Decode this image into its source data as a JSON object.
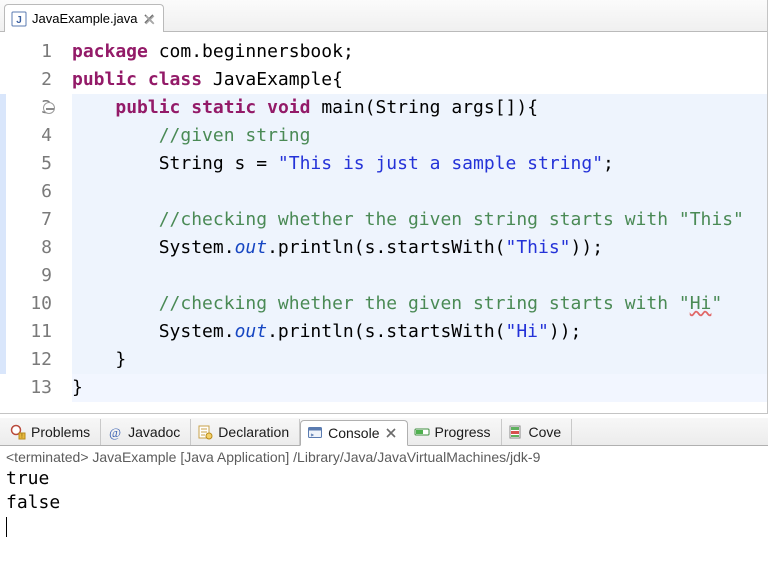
{
  "editor": {
    "tab": {
      "filename": "JavaExample.java"
    },
    "code_lines": [
      {
        "n": 1,
        "hl": false,
        "tokens": [
          [
            "kw",
            "package"
          ],
          [
            "",
            " "
          ],
          [
            "pkg",
            "com.beginnersbook"
          ],
          [
            "",
            ";"
          ]
        ]
      },
      {
        "n": 2,
        "hl": false,
        "tokens": [
          [
            "kw",
            "public"
          ],
          [
            "",
            " "
          ],
          [
            "kw",
            "class"
          ],
          [
            "",
            " "
          ],
          [
            "cls",
            "JavaExample"
          ],
          [
            "",
            "{"
          ]
        ]
      },
      {
        "n": 3,
        "hl": true,
        "fold": true,
        "tokens": [
          [
            "",
            "    "
          ],
          [
            "kw",
            "public"
          ],
          [
            "",
            " "
          ],
          [
            "kw",
            "static"
          ],
          [
            "",
            " "
          ],
          [
            "kw",
            "void"
          ],
          [
            "",
            " "
          ],
          [
            "",
            "main(String args[]){"
          ]
        ]
      },
      {
        "n": 4,
        "hl": true,
        "tokens": [
          [
            "",
            "        "
          ],
          [
            "cmt",
            "//given string"
          ]
        ]
      },
      {
        "n": 5,
        "hl": true,
        "tokens": [
          [
            "",
            "        "
          ],
          [
            "",
            "String s = "
          ],
          [
            "str",
            "\"This is just a sample string\""
          ],
          [
            "",
            ";"
          ]
        ]
      },
      {
        "n": 6,
        "hl": true,
        "tokens": []
      },
      {
        "n": 7,
        "hl": true,
        "tokens": [
          [
            "",
            "        "
          ],
          [
            "cmt",
            "//checking whether the given string starts with \"This\""
          ]
        ]
      },
      {
        "n": 8,
        "hl": true,
        "tokens": [
          [
            "",
            "        "
          ],
          [
            "",
            "System."
          ],
          [
            "fld",
            "out"
          ],
          [
            "",
            ".println(s.startsWith("
          ],
          [
            "str",
            "\"This\""
          ],
          [
            "",
            "));"
          ]
        ]
      },
      {
        "n": 9,
        "hl": true,
        "tokens": []
      },
      {
        "n": 10,
        "hl": true,
        "tokens": [
          [
            "",
            "        "
          ],
          [
            "cmt",
            "//checking whether the given string starts with \""
          ],
          [
            "cmt err",
            "Hi"
          ],
          [
            "cmt",
            "\""
          ]
        ]
      },
      {
        "n": 11,
        "hl": true,
        "tokens": [
          [
            "",
            "        "
          ],
          [
            "",
            "System."
          ],
          [
            "fld",
            "out"
          ],
          [
            "",
            ".println(s.startsWith("
          ],
          [
            "str",
            "\"Hi\""
          ],
          [
            "",
            "));"
          ]
        ]
      },
      {
        "n": 12,
        "hl": true,
        "tokens": [
          [
            "",
            "    }"
          ]
        ]
      },
      {
        "n": 13,
        "hl": false,
        "caret": true,
        "tokens": [
          [
            "",
            "}"
          ]
        ]
      }
    ]
  },
  "views": {
    "tabs": [
      {
        "id": "problems",
        "label": "Problems",
        "icon": "problems-icon"
      },
      {
        "id": "javadoc",
        "label": "Javadoc",
        "icon": "javadoc-icon"
      },
      {
        "id": "declaration",
        "label": "Declaration",
        "icon": "declaration-icon"
      },
      {
        "id": "console",
        "label": "Console",
        "icon": "console-icon",
        "active": true,
        "closable": true
      },
      {
        "id": "progress",
        "label": "Progress",
        "icon": "progress-icon"
      },
      {
        "id": "coverage",
        "label": "Cove",
        "icon": "coverage-icon"
      }
    ]
  },
  "console": {
    "header": "<terminated> JavaExample [Java Application] /Library/Java/JavaVirtualMachines/jdk-9",
    "lines": [
      "true",
      "false"
    ]
  }
}
